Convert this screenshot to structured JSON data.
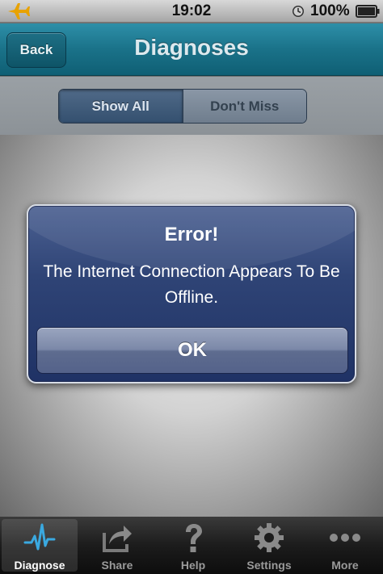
{
  "status_bar": {
    "time": "19:02",
    "battery_percent": "100%",
    "airplane_icon": "airplane-icon",
    "clock_icon": "clock-icon",
    "battery_icon": "battery-icon"
  },
  "nav": {
    "back_label": "Back",
    "title": "Diagnoses"
  },
  "segments": [
    {
      "label": "Show All",
      "selected": true
    },
    {
      "label": "Don't Miss",
      "selected": false
    }
  ],
  "alert": {
    "title": "Error!",
    "message": "The Internet Connection Appears To Be Offline.",
    "ok_label": "OK"
  },
  "tabs": [
    {
      "label": "Diagnose",
      "icon": "pulse-icon",
      "selected": true
    },
    {
      "label": "Share",
      "icon": "share-icon",
      "selected": false
    },
    {
      "label": "Help",
      "icon": "question-icon",
      "selected": false
    },
    {
      "label": "Settings",
      "icon": "gear-icon",
      "selected": false
    },
    {
      "label": "More",
      "icon": "more-dots-icon",
      "selected": false
    }
  ],
  "colors": {
    "nav_bar": "#1a7289",
    "alert_background": "#2f4476",
    "airplane": "#e8a200",
    "tab_active_icon": "#3aa9e0"
  }
}
